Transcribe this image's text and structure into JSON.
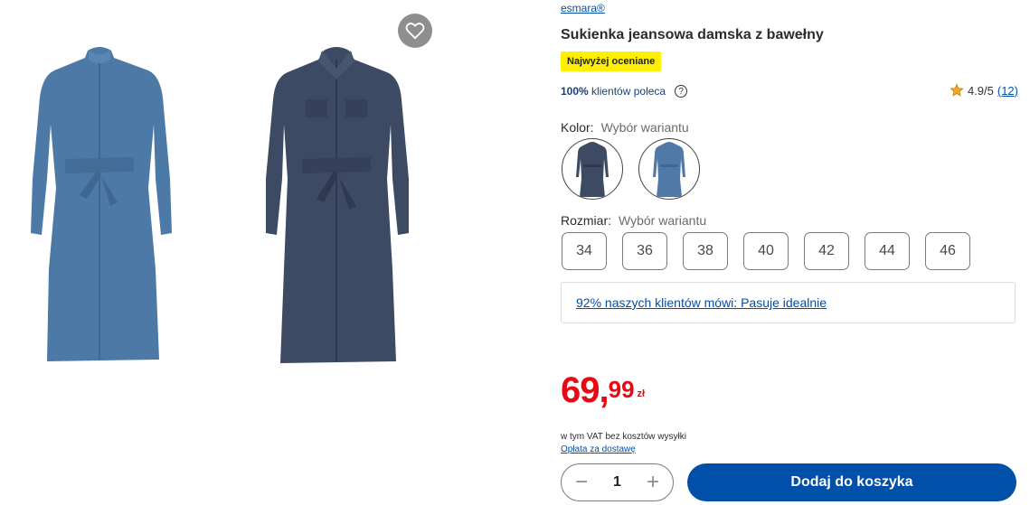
{
  "product": {
    "brand": "esmara®",
    "title": "Sukienka jeansowa damska z bawełny",
    "badge": "Najwyżej oceniane",
    "recommend_pct": "100%",
    "recommend_text": "klientów poleca",
    "rating": "4.9/5",
    "rating_count": "(12)"
  },
  "color": {
    "label": "Kolor:",
    "hint": "Wybór wariantu",
    "swatches": [
      "dark-denim-dress",
      "light-denim-dress"
    ]
  },
  "size": {
    "label": "Rozmiar:",
    "hint": "Wybór wariantu",
    "options": [
      "34",
      "36",
      "38",
      "40",
      "42",
      "44",
      "46"
    ]
  },
  "fit": {
    "text": "92% naszych klientów mówi: Pasuje idealnie"
  },
  "price": {
    "main": "69,",
    "cents": "99",
    "currency": "zł",
    "vat_note": "w tym VAT bez kosztów wysyłki",
    "shipping_link": "Opłata za dostawę"
  },
  "cart": {
    "minus": "−",
    "quantity": "1",
    "plus": "+",
    "add_label": "Dodaj do koszyka"
  },
  "colors": {
    "accent_blue": "#0050aa",
    "price_red": "#e60a14",
    "badge_yellow": "#fff000",
    "light_denim": "#4f7aa8",
    "dark_denim": "#3d4a63"
  }
}
